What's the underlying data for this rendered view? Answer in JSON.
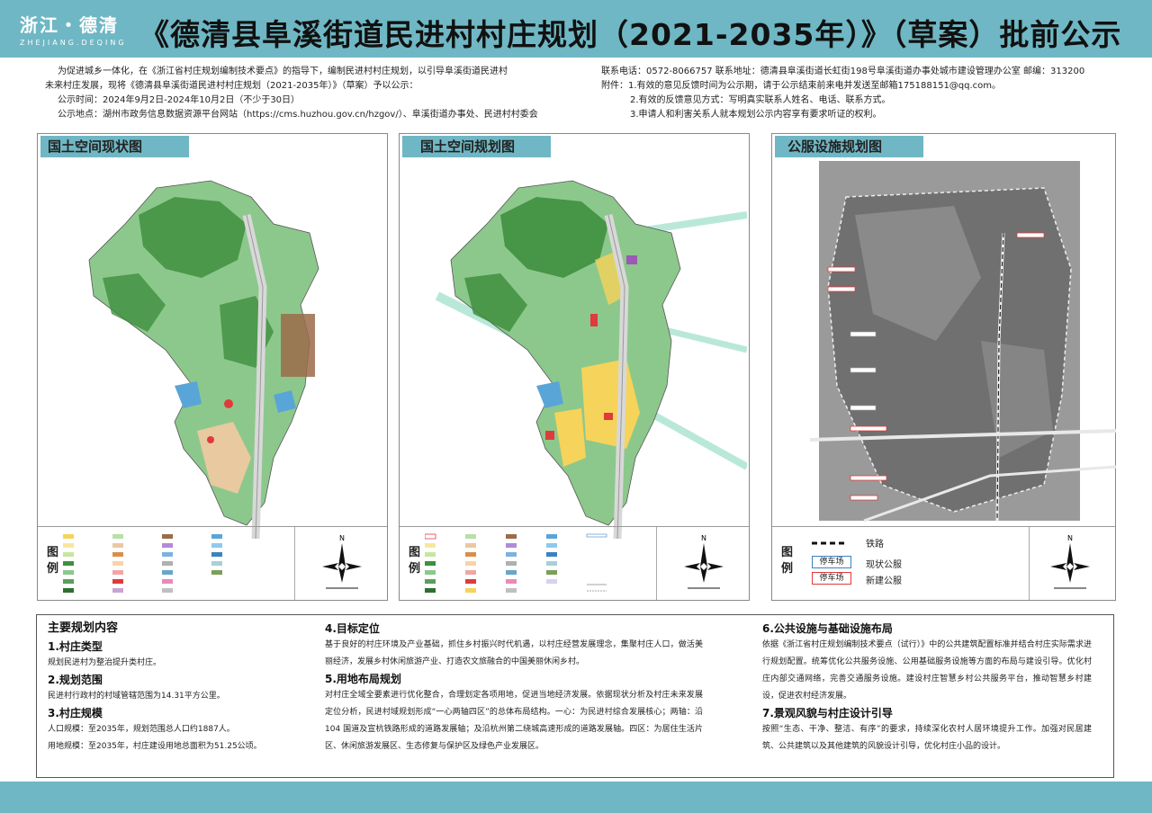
{
  "header": {
    "logo_line1": "浙江・德清",
    "logo_line2": "ZHEJIANG.DEQING",
    "title": "《德清县阜溪街道民进村村庄规划（2021-2035年）》（草案）批前公示"
  },
  "intro_left": {
    "line1": "为促进城乡一体化，在《浙江省村庄规划编制技术要点》的指导下，编制民进村村庄规划，以引导阜溪街道民进村",
    "line2": "未来村庄发展，现将《德清县阜溪街道民进村村庄规划（2021-2035年）》（草案）予以公示：",
    "line3": "公示时间：2024年9月2日-2024年10月2日（不少于30日）",
    "line4": "公示地点：湖州市政务信息数据资源平台网站（https://cms.huzhou.gov.cn/hzgov/）、阜溪街道办事处、民进村村委会"
  },
  "intro_right": {
    "line1": "联系电话：0572-8066757      联系地址：德清县阜溪街道长虹街198号阜溪街道办事处城市建设管理办公室      邮编：313200",
    "line2": "附件：1.有效的意见反馈时间为公示期，请于公示结束前来电并发送至邮箱175188151@qq.com。",
    "line3": "2.有效的反馈意见方式：写明真实联系人姓名、电话、联系方式。",
    "line4": "3.申请人和利害关系人就本规划公示内容享有要求听证的权利。"
  },
  "panels": [
    {
      "title": "国土空间现状图",
      "legend_label": "图例"
    },
    {
      "title": "国土空间规划图",
      "legend_label": "图例"
    },
    {
      "title": "公服设施规划图",
      "legend_label": "图例"
    }
  ],
  "public_legend": {
    "railway": "铁路",
    "parking": "停车场",
    "existing": "现状公服",
    "new": "新建公服"
  },
  "content": {
    "heading": "主要规划内容",
    "s1_title": "1.村庄类型",
    "s1_text": "规划民进村为整治提升类村庄。",
    "s2_title": "2.规划范围",
    "s2_text": "民进村行政村的村域管辖范围为14.31平方公里。",
    "s3_title": "3.村庄规模",
    "s3_text1": "人口规模：至2035年，规划范围总人口约1887人。",
    "s3_text2": "用地规模：至2035年，村庄建设用地总面积为51.25公顷。",
    "s4_title": "4.目标定位",
    "s4_text": "基于良好的村庄环境及产业基础，抓住乡村振兴时代机遇，以村庄经营发展理念，集聚村庄人口，做活美丽经济，发展乡村休闲旅游产业、打造农文旅融合的中国美丽休闲乡村。",
    "s5_title": "5.用地布局规划",
    "s5_text": "对村庄全域全要素进行优化整合，合理划定各项用地，促进当地经济发展。依据现状分析及村庄未来发展定位分析，民进村域规划形成“一心两轴四区”的总体布局结构。一心：为民进村综合发展核心；两轴：沿 104 国道及宣杭铁路形成的道路发展轴；及沿杭州第二绕城高速形成的道路发展轴。四区：为居住生活片区、休闲旅游发展区、生态修复与保护区及绿色产业发展区。",
    "s6_title": "6.公共设施与基础设施布局",
    "s6_text": "依据《浙江省村庄规划编制技术要点（试行）》中的公共建筑配置标准并结合村庄实际需求进行规划配置。统筹优化公共服务设施、公用基础服务设施等方面的布局与建设引导。优化村庄内部交通网络，完善交通服务设施。建设村庄智慧乡村公共服务平台，推动智慧乡村建设，促进农村经济发展。",
    "s7_title": "7.景观风貌与村庄设计引导",
    "s7_text": "按照“生态、干净、整洁、有序”的要求，持续深化农村人居环境提升工作。加强对民居建筑、公共建筑以及其他建筑的风貌设计引导，优化村庄小品的设计。"
  },
  "colors": {
    "header": "#6fb7c4",
    "forest": "#3f8f3f",
    "light_forest": "#8cc88c",
    "residential": "#f6d35a",
    "industrial": "#9b6b4a",
    "water": "#5aa5d8",
    "public": "#e03a3a"
  }
}
